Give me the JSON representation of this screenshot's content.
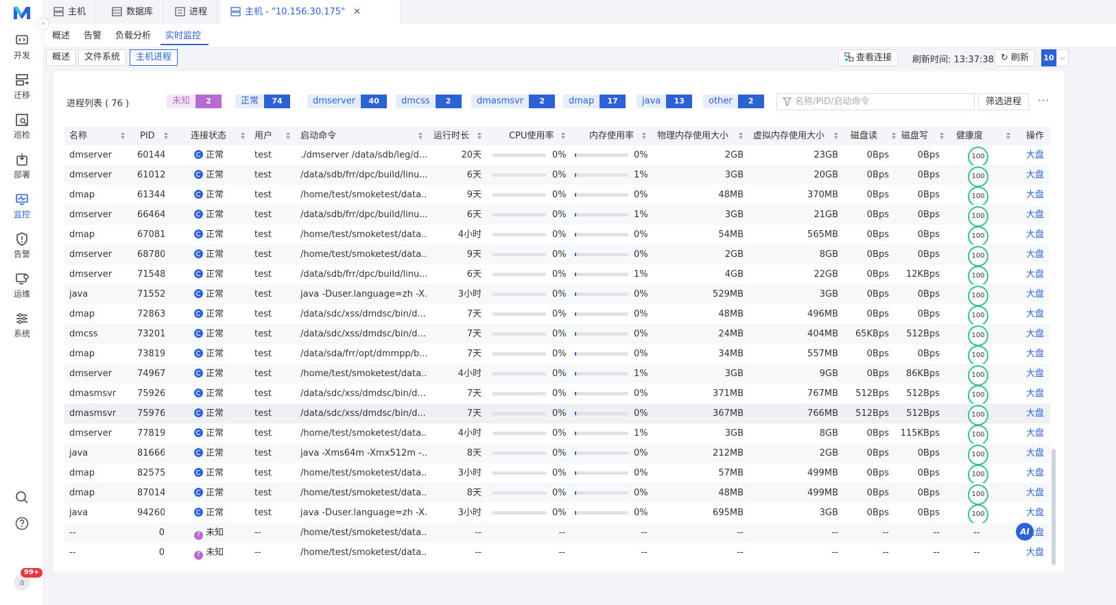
{
  "sidebar": {
    "items": [
      {
        "label": "开发",
        "icon": "dev-icon"
      },
      {
        "label": "迁移",
        "icon": "migrate-icon"
      },
      {
        "label": "巡检",
        "icon": "inspect-icon"
      },
      {
        "label": "部署",
        "icon": "deploy-icon"
      },
      {
        "label": "监控",
        "icon": "monitor-icon",
        "active": true
      },
      {
        "label": "告警",
        "icon": "alert-icon"
      },
      {
        "label": "运维",
        "icon": "ops-icon"
      },
      {
        "label": "系统",
        "icon": "system-icon"
      }
    ],
    "avatar": "a",
    "notif_badge": "99+"
  },
  "tabs": [
    {
      "label": "主机",
      "icon": "server-icon"
    },
    {
      "label": "数据库",
      "icon": "database-icon"
    },
    {
      "label": "进程",
      "icon": "process-icon"
    },
    {
      "label": "主机 - \"10.156.30.175\"",
      "icon": "server-icon",
      "active": true,
      "closable": true
    }
  ],
  "subnav": [
    "概述",
    "告警",
    "负载分析",
    "实时监控"
  ],
  "segments": [
    "概述",
    "文件系统",
    "主机进程"
  ],
  "toolbar": {
    "view_connections": "查看连接",
    "refresh_time": "刷新时间: 13:37:38",
    "refresh": "刷新",
    "interval": "10"
  },
  "process_list": {
    "title": "进程列表 ( 76 )",
    "chips": [
      {
        "label": "未知",
        "count": "2",
        "bg": "#f7e6f7",
        "color": "#b86ad0",
        "count_bg": "#b86ad0"
      },
      {
        "label": "正常",
        "count": "74",
        "bg": "#e6edfb",
        "color": "#2c62d6",
        "count_bg": "#2c62d6"
      },
      {
        "label": "dmserver",
        "count": "40",
        "bg": "#e6edfb",
        "color": "#2c62d6",
        "count_bg": "#2c62d6"
      },
      {
        "label": "dmcss",
        "count": "2",
        "bg": "#e6edfb",
        "color": "#2c62d6",
        "count_bg": "#2c62d6"
      },
      {
        "label": "dmasmsvr",
        "count": "2",
        "bg": "#e6edfb",
        "color": "#2c62d6",
        "count_bg": "#2c62d6"
      },
      {
        "label": "dmap",
        "count": "17",
        "bg": "#e6edfb",
        "color": "#2c62d6",
        "count_bg": "#2c62d6"
      },
      {
        "label": "java",
        "count": "13",
        "bg": "#e6edfb",
        "color": "#2c62d6",
        "count_bg": "#2c62d6"
      },
      {
        "label": "other",
        "count": "2",
        "bg": "#e6edfb",
        "color": "#2c62d6",
        "count_bg": "#2c62d6"
      }
    ],
    "filter_placeholder": "名称/PID/启动命令",
    "filter_button": "筛选进程",
    "more": "···"
  },
  "table": {
    "headers": [
      "名称",
      "PID",
      "连接状态",
      "用户",
      "启动命令",
      "运行时长",
      "CPU使用率",
      "内存使用率",
      "物理内存使用大小",
      "虚拟内存使用大小",
      "磁盘读",
      "磁盘写",
      "健康度",
      "操作"
    ],
    "rows": [
      {
        "name": "dmserver",
        "pid": "60144",
        "status": "正常",
        "user": "test",
        "cmd": "./dmserver /data/sdb/leg/d...",
        "uptime": "20天",
        "cpu": "0%",
        "cpu_v": 0,
        "mem": "0%",
        "mem_v": 0.01,
        "rss": "2GB",
        "vms": "23GB",
        "dr": "0Bps",
        "dw": "0Bps",
        "health": "100",
        "op": "大盘"
      },
      {
        "name": "dmserver",
        "pid": "61012",
        "status": "正常",
        "user": "test",
        "cmd": "/data/sdb/frr/dpc/build/linu...",
        "uptime": "6天",
        "cpu": "0%",
        "cpu_v": 0,
        "mem": "1%",
        "mem_v": 0.02,
        "rss": "3GB",
        "vms": "20GB",
        "dr": "0Bps",
        "dw": "0Bps",
        "health": "100",
        "op": "大盘"
      },
      {
        "name": "dmap",
        "pid": "61344",
        "status": "正常",
        "user": "test",
        "cmd": "/home/test/smoketest/data...",
        "uptime": "9天",
        "cpu": "0%",
        "cpu_v": 0,
        "mem": "0%",
        "mem_v": 0,
        "rss": "48MB",
        "vms": "370MB",
        "dr": "0Bps",
        "dw": "0Bps",
        "health": "100",
        "op": "大盘"
      },
      {
        "name": "dmserver",
        "pid": "66464",
        "status": "正常",
        "user": "test",
        "cmd": "/data/sdb/frr/dpc/build/linu...",
        "uptime": "6天",
        "cpu": "0%",
        "cpu_v": 0,
        "mem": "1%",
        "mem_v": 0.02,
        "rss": "3GB",
        "vms": "21GB",
        "dr": "0Bps",
        "dw": "0Bps",
        "health": "100",
        "op": "大盘"
      },
      {
        "name": "dmap",
        "pid": "67081",
        "status": "正常",
        "user": "test",
        "cmd": "/home/test/smoketest/data...",
        "uptime": "4小时",
        "cpu": "0%",
        "cpu_v": 0,
        "mem": "0%",
        "mem_v": 0,
        "rss": "54MB",
        "vms": "565MB",
        "dr": "0Bps",
        "dw": "0Bps",
        "health": "100",
        "op": "大盘"
      },
      {
        "name": "dmserver",
        "pid": "68780",
        "status": "正常",
        "user": "test",
        "cmd": "/home/test/smoketest/data...",
        "uptime": "9天",
        "cpu": "0%",
        "cpu_v": 0,
        "mem": "0%",
        "mem_v": 0.01,
        "rss": "2GB",
        "vms": "8GB",
        "dr": "0Bps",
        "dw": "0Bps",
        "health": "100",
        "op": "大盘"
      },
      {
        "name": "dmserver",
        "pid": "71548",
        "status": "正常",
        "user": "test",
        "cmd": "/data/sdb/frr/dpc/build/linu...",
        "uptime": "6天",
        "cpu": "0%",
        "cpu_v": 0,
        "mem": "1%",
        "mem_v": 0.02,
        "rss": "4GB",
        "vms": "22GB",
        "dr": "0Bps",
        "dw": "12KBps",
        "health": "100",
        "op": "大盘"
      },
      {
        "name": "java",
        "pid": "71552",
        "status": "正常",
        "user": "test",
        "cmd": "java -Duser.language=zh -X...",
        "uptime": "3小时",
        "cpu": "0%",
        "cpu_v": 0,
        "mem": "0%",
        "mem_v": 0.01,
        "rss": "529MB",
        "vms": "3GB",
        "dr": "0Bps",
        "dw": "0Bps",
        "health": "100",
        "op": "大盘"
      },
      {
        "name": "dmap",
        "pid": "72863",
        "status": "正常",
        "user": "test",
        "cmd": "/data/sdc/xss/dmdsc/bin/d...",
        "uptime": "7天",
        "cpu": "0%",
        "cpu_v": 0,
        "mem": "0%",
        "mem_v": 0,
        "rss": "48MB",
        "vms": "496MB",
        "dr": "0Bps",
        "dw": "0Bps",
        "health": "100",
        "op": "大盘"
      },
      {
        "name": "dmcss",
        "pid": "73201",
        "status": "正常",
        "user": "test",
        "cmd": "/data/sdc/xss/dmdsc/bin/d...",
        "uptime": "7天",
        "cpu": "0%",
        "cpu_v": 0,
        "mem": "0%",
        "mem_v": 0,
        "rss": "24MB",
        "vms": "404MB",
        "dr": "65KBps",
        "dw": "512Bps",
        "health": "100",
        "op": "大盘"
      },
      {
        "name": "dmap",
        "pid": "73819",
        "status": "正常",
        "user": "test",
        "cmd": "/data/sda/frr/opt/dmmpp/b...",
        "uptime": "7天",
        "cpu": "0%",
        "cpu_v": 0,
        "mem": "0%",
        "mem_v": 0,
        "rss": "34MB",
        "vms": "557MB",
        "dr": "0Bps",
        "dw": "0Bps",
        "health": "100",
        "op": "大盘"
      },
      {
        "name": "dmserver",
        "pid": "74967",
        "status": "正常",
        "user": "test",
        "cmd": "/home/test/smoketest/data...",
        "uptime": "4小时",
        "cpu": "0%",
        "cpu_v": 0,
        "mem": "1%",
        "mem_v": 0.02,
        "rss": "3GB",
        "vms": "9GB",
        "dr": "0Bps",
        "dw": "86KBps",
        "health": "100",
        "op": "大盘"
      },
      {
        "name": "dmasmsvr",
        "pid": "75926",
        "status": "正常",
        "user": "test",
        "cmd": "/data/sdc/xss/dmdsc/bin/d...",
        "uptime": "7天",
        "cpu": "0%",
        "cpu_v": 0,
        "mem": "0%",
        "mem_v": 0.01,
        "rss": "371MB",
        "vms": "767MB",
        "dr": "512Bps",
        "dw": "512Bps",
        "health": "100",
        "op": "大盘"
      },
      {
        "name": "dmasmsvr",
        "pid": "75976",
        "status": "正常",
        "user": "test",
        "cmd": "/data/sdc/xss/dmdsc/bin/d...",
        "uptime": "7天",
        "cpu": "0%",
        "cpu_v": 0,
        "mem": "0%",
        "mem_v": 0.01,
        "rss": "367MB",
        "vms": "766MB",
        "dr": "512Bps",
        "dw": "512Bps",
        "health": "100",
        "op": "大盘"
      },
      {
        "name": "dmserver",
        "pid": "77819",
        "status": "正常",
        "user": "test",
        "cmd": "/home/test/smoketest/data...",
        "uptime": "4小时",
        "cpu": "0%",
        "cpu_v": 0,
        "mem": "1%",
        "mem_v": 0.02,
        "rss": "3GB",
        "vms": "8GB",
        "dr": "0Bps",
        "dw": "115KBps",
        "health": "100",
        "op": "大盘"
      },
      {
        "name": "java",
        "pid": "81666",
        "status": "正常",
        "user": "test",
        "cmd": "java -Xms64m -Xmx512m -...",
        "uptime": "8天",
        "cpu": "0%",
        "cpu_v": 0,
        "mem": "0%",
        "mem_v": 0,
        "rss": "212MB",
        "vms": "2GB",
        "dr": "0Bps",
        "dw": "0Bps",
        "health": "100",
        "op": "大盘"
      },
      {
        "name": "dmap",
        "pid": "82575",
        "status": "正常",
        "user": "test",
        "cmd": "/home/test/smoketest/data...",
        "uptime": "3小时",
        "cpu": "0%",
        "cpu_v": 0,
        "mem": "0%",
        "mem_v": 0,
        "rss": "57MB",
        "vms": "499MB",
        "dr": "0Bps",
        "dw": "0Bps",
        "health": "100",
        "op": "大盘"
      },
      {
        "name": "dmap",
        "pid": "87014",
        "status": "正常",
        "user": "test",
        "cmd": "/home/test/smoketest/data...",
        "uptime": "8天",
        "cpu": "0%",
        "cpu_v": 0,
        "mem": "0%",
        "mem_v": 0,
        "rss": "48MB",
        "vms": "499MB",
        "dr": "0Bps",
        "dw": "0Bps",
        "health": "100",
        "op": "大盘"
      },
      {
        "name": "java",
        "pid": "94260",
        "status": "正常",
        "user": "test",
        "cmd": "java -Duser.language=zh -X...",
        "uptime": "3小时",
        "cpu": "0%",
        "cpu_v": 0,
        "mem": "0%",
        "mem_v": 0.01,
        "rss": "695MB",
        "vms": "3GB",
        "dr": "0Bps",
        "dw": "0Bps",
        "health": "100",
        "op": "大盘"
      },
      {
        "name": "--",
        "pid": "0",
        "status": "未知",
        "user": "--",
        "cmd": "/home/test/smoketest/data...",
        "uptime": "--",
        "cpu": "--",
        "cpu_v": null,
        "mem": "--",
        "mem_v": null,
        "rss": "--",
        "vms": "--",
        "dr": "--",
        "dw": "--",
        "health": "--",
        "op": "大盘"
      },
      {
        "name": "--",
        "pid": "0",
        "status": "未知",
        "user": "--",
        "cmd": "/home/test/smoketest/data...",
        "uptime": "--",
        "cpu": "--",
        "cpu_v": null,
        "mem": "--",
        "mem_v": null,
        "rss": "--",
        "vms": "--",
        "dr": "--",
        "dw": "--",
        "health": "--",
        "op": "大盘"
      }
    ]
  },
  "ai_button": "AI",
  "colors": {
    "accent": "#2c62d6",
    "health_ring": "#34c08a",
    "unknown": "#b86ad0"
  }
}
